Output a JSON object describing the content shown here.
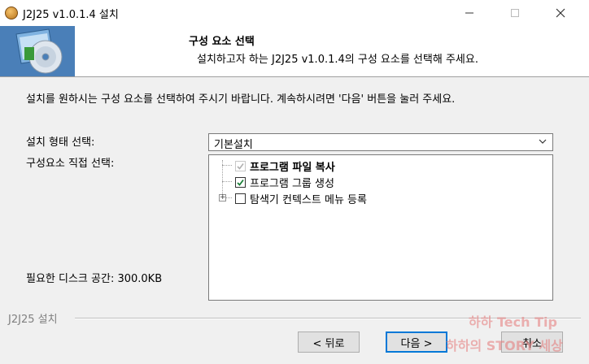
{
  "window": {
    "title": "J2J25 v1.0.1.4 설치"
  },
  "header": {
    "title": "구성 요소 선택",
    "subtitle": "설치하고자 하는 J2J25 v1.0.1.4의 구성 요소를 선택해 주세요."
  },
  "body": {
    "description": "설치를 원하시는 구성 요소를 선택하여 주시기 바랍니다. 계속하시려면 '다음' 버튼을 눌러 주세요.",
    "install_type_label": "설치 형태 선택:",
    "install_type_value": "기본설치",
    "components_label": "구성요소 직접 선택:",
    "disk_space_label": "필요한 디스크 공간: 300.0KB",
    "components": [
      {
        "label": "프로그램 파일 복사",
        "checked": true,
        "disabled": true,
        "bold": true
      },
      {
        "label": "프로그램 그룹 생성",
        "checked": true,
        "disabled": false,
        "bold": false
      },
      {
        "label": "탐색기 컨텍스트 메뉴 등록",
        "checked": false,
        "disabled": false,
        "bold": false,
        "expandable": true
      }
    ]
  },
  "footer": {
    "brand": "J2J25 설치",
    "back_label": "< 뒤로",
    "next_label": "다음 >",
    "cancel_label": "취소"
  },
  "watermark": {
    "line1": "하하 Tech Tip",
    "line2": "하하의 STORY 세상"
  },
  "colors": {
    "accent": "#0078d7",
    "check": "#1a7f37"
  }
}
